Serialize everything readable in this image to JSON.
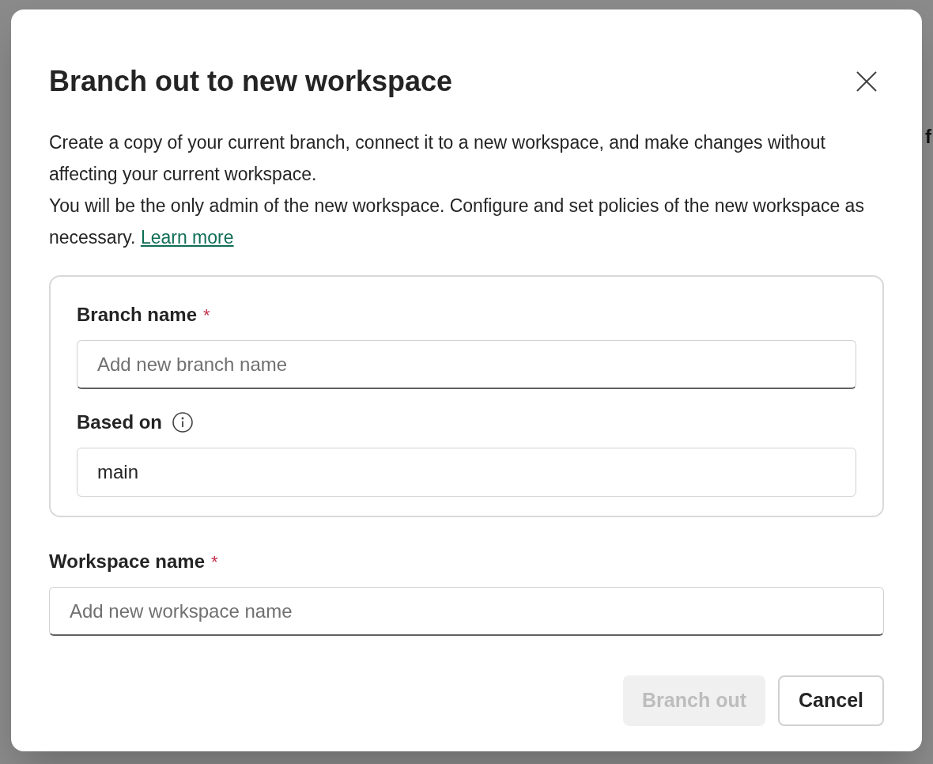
{
  "background": {
    "partial_text": "f"
  },
  "dialog": {
    "title": "Branch out to new workspace",
    "description": [
      "Create a copy of your current branch, connect it to a new workspace, and make changes without affecting your current workspace.",
      "You will be the only admin of the new workspace. Configure and set policies of the new workspace as necessary."
    ],
    "learn_more_link": "Learn more",
    "branch_group": {
      "fields": [
        {
          "label": "Branch name",
          "required_mark": "*",
          "info": false,
          "placeholder": "Add new branch name"
        },
        {
          "label": "Based on",
          "info": true,
          "value": "main"
        }
      ]
    },
    "workspace_field": {
      "label": "Workspace name",
      "required_mark": "*",
      "placeholder": "Add new workspace name"
    },
    "buttons": [
      {
        "label": "Branch out",
        "disabled": true
      },
      {
        "label": "Cancel",
        "disabled": false
      }
    ]
  }
}
